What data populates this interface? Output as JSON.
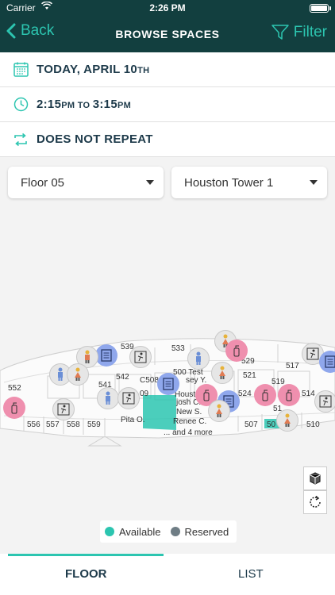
{
  "status_bar": {
    "carrier": "Carrier",
    "time": "2:26 PM"
  },
  "nav": {
    "back_label": "Back",
    "title": "BROWSE SPACES",
    "filter_label": "Filter"
  },
  "date_row": {
    "text_main": "TODAY, APRIL 10",
    "text_suffix": "TH"
  },
  "time_row": {
    "start": "2:15",
    "start_suffix": "PM",
    "to": " TO ",
    "end": "3:15",
    "end_suffix": "PM"
  },
  "repeat_row": {
    "text": "DOES NOT REPEAT"
  },
  "filters": {
    "floor": "Floor 05",
    "building": "Houston Tower 1"
  },
  "map": {
    "rooms": [
      "533",
      "539",
      "517",
      "542",
      "C508",
      "500 Test",
      "529",
      "521",
      "519",
      "541",
      "552",
      "09",
      "Houston",
      "524",
      "514",
      "51",
      "556",
      "557",
      "558",
      "559",
      "Pita O.",
      "507",
      "50",
      "510",
      "sey Y.",
      "josh C.",
      "New S.",
      "Renee C.",
      "... and 4 more"
    ]
  },
  "legend": {
    "available": "Available",
    "reserved": "Reserved"
  },
  "tabs": {
    "floor": "FLOOR",
    "list": "LIST"
  },
  "colors": {
    "accent": "#2cc5b0",
    "header": "#123f3f",
    "reserved": "#6f7d85"
  }
}
